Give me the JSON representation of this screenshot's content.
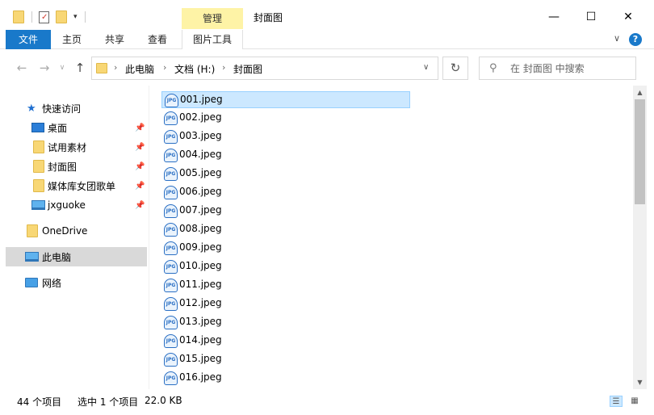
{
  "window": {
    "title": "封面图",
    "context_tab": "管理",
    "minimize": "—",
    "maximize": "☐",
    "close": "✕"
  },
  "ribbon": {
    "tabs": [
      "文件",
      "主页",
      "共享",
      "查看",
      "图片工具"
    ],
    "expand": "∨",
    "help": "?"
  },
  "nav": {
    "back": "←",
    "forward": "→",
    "recent": "∨",
    "up": "↑",
    "address": [
      "此电脑",
      "文档 (H:)",
      "封面图"
    ],
    "sep": "›",
    "dropdown": "∨",
    "refresh": "↻"
  },
  "search": {
    "placeholder": "在 封面图 中搜索"
  },
  "sidebar": {
    "items": [
      {
        "label": "快速访问",
        "icon": "star-icon"
      },
      {
        "label": "桌面",
        "icon": "desktop-icon",
        "pinned": true
      },
      {
        "label": "试用素材",
        "icon": "folder-icon",
        "pinned": true
      },
      {
        "label": "封面图",
        "icon": "folder-icon",
        "pinned": true
      },
      {
        "label": "媒体库女团歌单",
        "icon": "folder-icon",
        "pinned": true
      },
      {
        "label": "jxguoke",
        "icon": "computer-icon",
        "pinned": true
      },
      {
        "label": "OneDrive",
        "icon": "folder-icon"
      },
      {
        "label": "此电脑",
        "icon": "pc-icon",
        "selected": true
      },
      {
        "label": "网络",
        "icon": "network-icon"
      }
    ],
    "pin_glyph": "📌"
  },
  "files": {
    "icon_text": "JPG",
    "items": [
      "001.jpeg",
      "002.jpeg",
      "003.jpeg",
      "004.jpeg",
      "005.jpeg",
      "006.jpeg",
      "007.jpeg",
      "008.jpeg",
      "009.jpeg",
      "010.jpeg",
      "011.jpeg",
      "012.jpeg",
      "013.jpeg",
      "014.jpeg",
      "015.jpeg",
      "016.jpeg"
    ],
    "selected_index": 0
  },
  "scrollbar": {
    "up": "▲",
    "down": "▼"
  },
  "status": {
    "count": "44 个项目",
    "selection": "选中 1 个项目",
    "size": "22.0 KB",
    "details_view": "☰",
    "icons_view": "▦"
  },
  "colors": {
    "accent": "#1979ca",
    "context_tab": "#fef3a6",
    "selection": "#cce8ff",
    "selection_border": "#99d1ff"
  }
}
